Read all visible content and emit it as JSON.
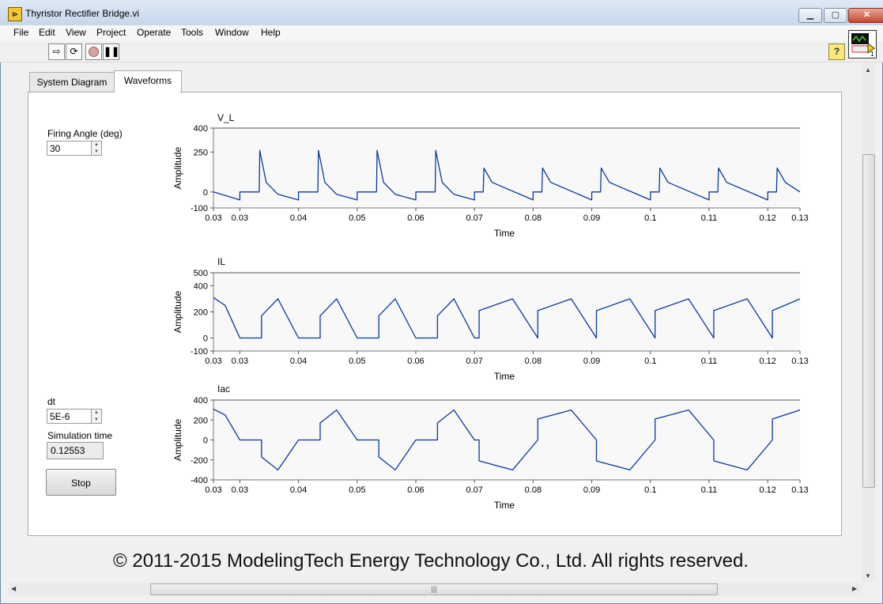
{
  "window": {
    "title": "Thyristor Rectifier Bridge.vi",
    "app_icon": "labview-vi-icon",
    "buttons": [
      "minimize",
      "maximize",
      "close"
    ]
  },
  "menu": [
    "File",
    "Edit",
    "View",
    "Project",
    "Operate",
    "Tools",
    "Window",
    "Help"
  ],
  "toolbar": {
    "run_icon": "run-arrow-icon",
    "run_continuous_icon": "run-continuously-icon",
    "abort_icon": "abort-icon",
    "pause_icon": "pause-icon",
    "help_label": "?"
  },
  "tabs": [
    {
      "label": "System Diagram",
      "active": false
    },
    {
      "label": "Waveforms",
      "active": true
    }
  ],
  "controls": {
    "firing_angle": {
      "label": "Firing Angle (deg)",
      "value": "30"
    },
    "dt": {
      "label": "dt",
      "value": "5E-6"
    },
    "simulation_time": {
      "label": "Simulation time",
      "value": "0.12553"
    },
    "stop_label": "Stop"
  },
  "copyright": "© 2011-2015 ModelingTech Energy Technology Co., Ltd. All rights reserved.",
  "colors": {
    "trace": "#0b3a9e",
    "plot_bg": "#f8f8f8",
    "grid": "#c8c8c8"
  },
  "chart_data": [
    {
      "type": "line",
      "title": "V_L",
      "xlabel": "Time",
      "ylabel": "Amplitude",
      "xlim": [
        0.0255,
        0.1255
      ],
      "ylim": [
        -100,
        400
      ],
      "yticks": [
        400,
        250,
        0,
        -100
      ],
      "xtick_labels": [
        "0.03",
        "0.03",
        "0.04",
        "0.05",
        "0.06",
        "0.07",
        "0.08",
        "0.09",
        "0.1",
        "0.11",
        "0.12",
        "0.13"
      ],
      "xtick_values": [
        0.0255,
        0.03,
        0.04,
        0.05,
        0.06,
        0.07,
        0.08,
        0.09,
        0.1,
        0.11,
        0.12,
        0.1255
      ],
      "series": [
        {
          "x": [
            0.0255,
            0.03,
            0.03,
            0.0333,
            0.0334,
            0.0345,
            0.0365,
            0.039,
            0.04,
            0.04,
            0.0433,
            0.0434,
            0.0445,
            0.0465,
            0.049,
            0.05,
            0.05,
            0.0533,
            0.0534,
            0.0545,
            0.0565,
            0.059,
            0.06,
            0.06,
            0.0633,
            0.0634,
            0.0645,
            0.0665,
            0.069,
            0.07,
            0.07,
            0.0715,
            0.0716,
            0.073,
            0.08,
            0.08,
            0.0815,
            0.0816,
            0.083,
            0.09,
            0.09,
            0.0915,
            0.0916,
            0.093,
            0.1,
            0.1,
            0.1015,
            0.1016,
            0.103,
            0.11,
            0.11,
            0.1115,
            0.1116,
            0.113,
            0.12,
            0.12,
            0.1215,
            0.1216,
            0.123,
            0.1255
          ],
          "y": [
            0,
            -50,
            0,
            0,
            260,
            60,
            -15,
            -40,
            -50,
            0,
            0,
            260,
            60,
            -15,
            -40,
            -50,
            0,
            0,
            260,
            60,
            -15,
            -40,
            -50,
            0,
            0,
            260,
            60,
            -15,
            -40,
            -50,
            0,
            0,
            150,
            60,
            -50,
            0,
            0,
            150,
            60,
            -50,
            0,
            0,
            150,
            60,
            -50,
            0,
            0,
            150,
            60,
            -50,
            0,
            0,
            150,
            60,
            -50,
            0,
            0,
            150,
            60,
            0
          ]
        }
      ]
    },
    {
      "type": "line",
      "title": "IL",
      "xlabel": "Time",
      "ylabel": "Amplitude",
      "xlim": [
        0.0255,
        0.1255
      ],
      "ylim": [
        -100,
        500
      ],
      "yticks": [
        500,
        400,
        200,
        0,
        -100
      ],
      "xtick_labels": [
        "0.03",
        "0.03",
        "0.04",
        "0.05",
        "0.06",
        "0.07",
        "0.08",
        "0.09",
        "0.1",
        "0.11",
        "0.12",
        "0.13"
      ],
      "xtick_values": [
        0.0255,
        0.03,
        0.04,
        0.05,
        0.06,
        0.07,
        0.08,
        0.09,
        0.1,
        0.11,
        0.12,
        0.1255
      ],
      "series": [
        {
          "x": [
            0.0255,
            0.0275,
            0.03,
            0.0337,
            0.0337,
            0.0365,
            0.04,
            0.0437,
            0.0437,
            0.0465,
            0.05,
            0.0537,
            0.0537,
            0.0565,
            0.06,
            0.0637,
            0.0637,
            0.0665,
            0.07,
            0.0708,
            0.0708,
            0.0765,
            0.0808,
            0.0808,
            0.0865,
            0.0908,
            0.0908,
            0.0965,
            0.1008,
            0.1008,
            0.1065,
            0.1108,
            0.1108,
            0.1165,
            0.1208,
            0.1208,
            0.1255
          ],
          "y": [
            310,
            250,
            0,
            0,
            170,
            300,
            0,
            0,
            170,
            300,
            0,
            0,
            170,
            300,
            0,
            0,
            170,
            300,
            0,
            0,
            210,
            300,
            0,
            210,
            300,
            0,
            210,
            300,
            0,
            210,
            300,
            0,
            210,
            300,
            0,
            210,
            300
          ]
        }
      ]
    },
    {
      "type": "line",
      "title": "Iac",
      "xlabel": "Time",
      "ylabel": "Amplitude",
      "xlim": [
        0.0255,
        0.1255
      ],
      "ylim": [
        -400,
        400
      ],
      "yticks": [
        400,
        200,
        0,
        -200,
        -400
      ],
      "xtick_labels": [
        "0.03",
        "0.03",
        "0.04",
        "0.05",
        "0.06",
        "0.07",
        "0.08",
        "0.09",
        "0.1",
        "0.11",
        "0.12",
        "0.13"
      ],
      "xtick_values": [
        0.0255,
        0.03,
        0.04,
        0.05,
        0.06,
        0.07,
        0.08,
        0.09,
        0.1,
        0.11,
        0.12,
        0.1255
      ],
      "series": [
        {
          "x": [
            0.0255,
            0.0275,
            0.03,
            0.0337,
            0.0337,
            0.0365,
            0.04,
            0.0437,
            0.0437,
            0.0465,
            0.05,
            0.0537,
            0.0537,
            0.0565,
            0.06,
            0.0637,
            0.0637,
            0.0665,
            0.07,
            0.0708,
            0.0708,
            0.0765,
            0.0808,
            0.0808,
            0.0865,
            0.0908,
            0.0908,
            0.0965,
            0.1008,
            0.1008,
            0.1065,
            0.1108,
            0.1108,
            0.1165,
            0.1208,
            0.1208,
            0.1255
          ],
          "y": [
            310,
            250,
            0,
            0,
            -170,
            -300,
            0,
            0,
            170,
            300,
            0,
            0,
            -170,
            -300,
            0,
            0,
            170,
            300,
            0,
            0,
            -210,
            -300,
            0,
            210,
            300,
            0,
            -210,
            -300,
            0,
            210,
            300,
            0,
            -210,
            -300,
            0,
            210,
            300
          ]
        }
      ]
    }
  ]
}
